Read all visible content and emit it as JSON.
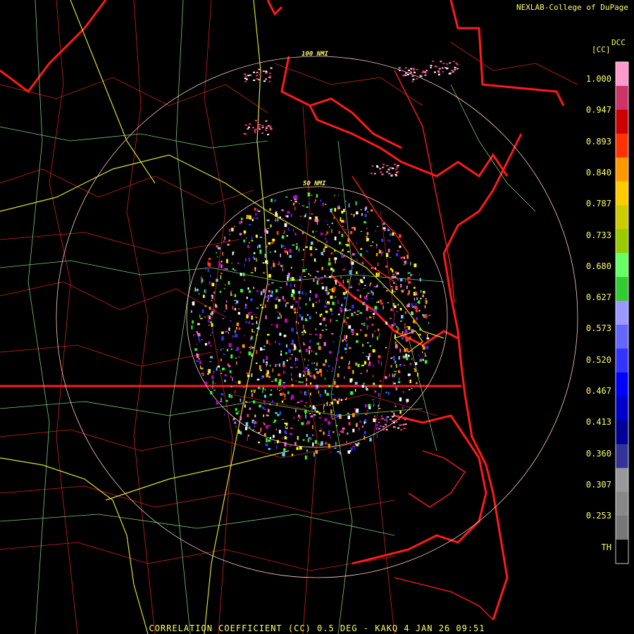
{
  "credit": "NEXLAB-College of DuPage",
  "legend": {
    "product_code": "DCC",
    "unit": "[CC]",
    "values": [
      "1.000",
      "0.947",
      "0.893",
      "0.840",
      "0.787",
      "0.733",
      "0.680",
      "0.627",
      "0.573",
      "0.520",
      "0.467",
      "0.413",
      "0.360",
      "0.307",
      "0.253",
      "TH"
    ],
    "color_stops": [
      "#ff99cc",
      "#cc3366",
      "#cc0000",
      "#ff3300",
      "#ff9900",
      "#ffcc00",
      "#cccc00",
      "#99cc00",
      "#66ff66",
      "#33cc33",
      "#9999ff",
      "#6666ff",
      "#3333ff",
      "#0000ff",
      "#0000cc",
      "#000099",
      "#333399",
      "#999999",
      "#888888",
      "#777777",
      "#000000"
    ]
  },
  "range_rings": {
    "inner_label": "50 NMI",
    "outer_label": "100 NMI"
  },
  "footer": "CORRELATION COEFFICIENT (CC) 0.5 DEG - KAKQ 4 JAN 26 09:51"
}
